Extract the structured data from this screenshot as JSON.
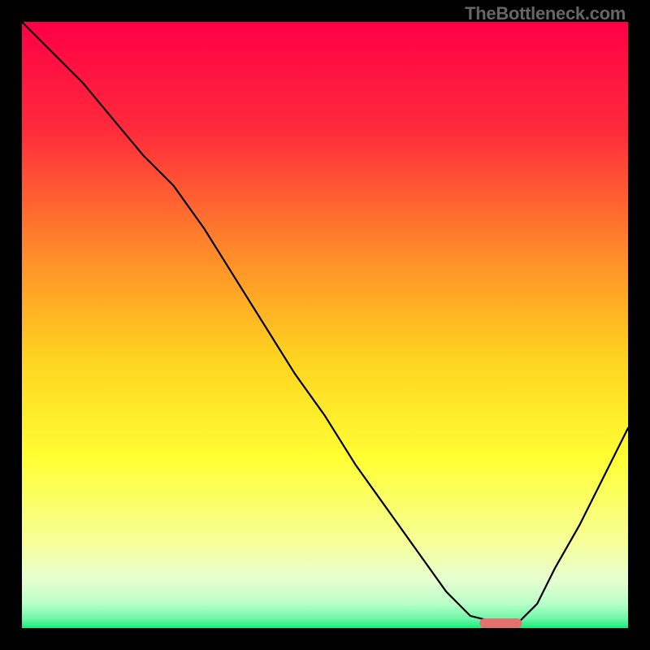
{
  "watermark": "TheBottleneck.com",
  "chart_data": {
    "type": "line",
    "title": "",
    "xlabel": "",
    "ylabel": "",
    "xlim": [
      0,
      100
    ],
    "ylim": [
      0,
      100
    ],
    "gradient_stops": [
      {
        "offset": 0,
        "color": "#ff0046"
      },
      {
        "offset": 0.18,
        "color": "#ff2b3b"
      },
      {
        "offset": 0.38,
        "color": "#ff8a2a"
      },
      {
        "offset": 0.55,
        "color": "#ffd21f"
      },
      {
        "offset": 0.72,
        "color": "#ffff33"
      },
      {
        "offset": 0.86,
        "color": "#f6ff9a"
      },
      {
        "offset": 0.92,
        "color": "#e6ffd0"
      },
      {
        "offset": 0.96,
        "color": "#b9ffc9"
      },
      {
        "offset": 0.985,
        "color": "#6cf7a6"
      },
      {
        "offset": 1.0,
        "color": "#17eb7a"
      }
    ],
    "series": [
      {
        "name": "curve",
        "x": [
          0,
          5,
          10,
          15,
          20,
          25,
          30,
          35,
          40,
          45,
          50,
          55,
          60,
          65,
          70,
          74,
          78,
          82,
          85,
          88,
          92,
          96,
          100
        ],
        "y": [
          100,
          95,
          90,
          84,
          78,
          73,
          66,
          58,
          50,
          42,
          35,
          27,
          20,
          13,
          6,
          2,
          1,
          1,
          4,
          10,
          17,
          25,
          33
        ]
      }
    ],
    "marker": {
      "color": "#e47070",
      "x0": 75.5,
      "x1": 82.5,
      "y": 0.8,
      "height": 1.6
    },
    "stroke": {
      "color": "#000",
      "width": 2.2
    }
  }
}
